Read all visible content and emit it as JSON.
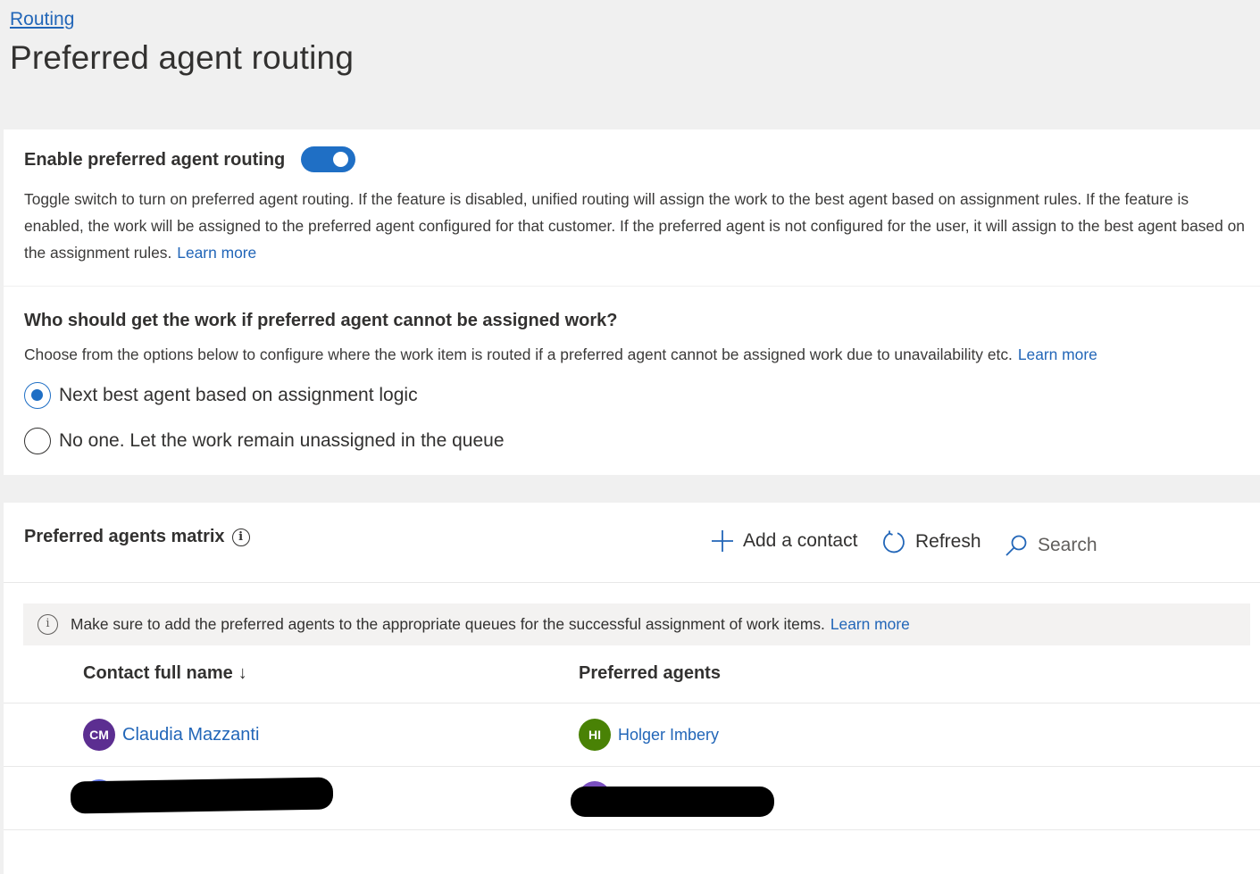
{
  "breadcrumb": {
    "label": "Routing"
  },
  "page": {
    "title": "Preferred agent routing"
  },
  "enable_section": {
    "title": "Enable preferred agent routing",
    "toggle_on": true,
    "description": "Toggle switch to turn on preferred agent routing. If the feature is disabled, unified routing will assign the work to the best agent based on assignment rules. If the feature is enabled, the work will be assigned to the preferred agent configured for that customer. If the preferred agent is not configured for the user, it will assign to the best agent based on the assignment rules.",
    "learn_more": "Learn more"
  },
  "fallback_section": {
    "title": "Who should get the work if preferred agent cannot be assigned work?",
    "description": "Choose from the options below to configure where the work item is routed if a preferred agent cannot be assigned work due to unavailability etc.",
    "learn_more": "Learn more",
    "options": [
      {
        "label": "Next best agent based on assignment logic",
        "selected": true
      },
      {
        "label": "No one. Let the work remain unassigned in the queue",
        "selected": false
      }
    ]
  },
  "matrix": {
    "title": "Preferred agents matrix",
    "add_contact_label": "Add a contact",
    "refresh_label": "Refresh",
    "search_placeholder": "Search",
    "banner_text": "Make sure to add the preferred agents to the appropriate queues for the successful assignment of work items.",
    "banner_link": "Learn more",
    "columns": [
      "Contact full name",
      "Preferred agents"
    ],
    "sort_arrow": "↓",
    "rows": [
      {
        "contact": {
          "initials": "CM",
          "name": "Claudia Mazzanti",
          "color": "#5c2e91"
        },
        "agent": {
          "initials": "HI",
          "name": "Holger Imbery",
          "color": "#498205"
        }
      }
    ]
  },
  "colors": {
    "accent": "#1f6fc5",
    "link": "#2266b8"
  }
}
